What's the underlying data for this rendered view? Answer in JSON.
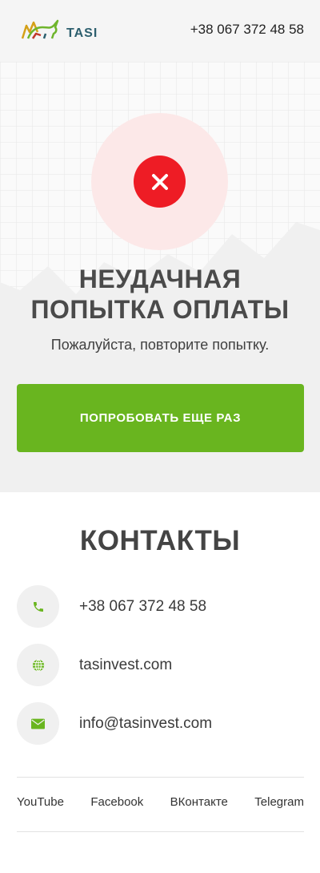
{
  "header": {
    "logo_text": "TASI",
    "phone": "+38 067 372 48 58"
  },
  "hero": {
    "title_line1": "НЕУДАЧНАЯ",
    "title_line2": "ПОПЫТКА ОПЛАТЫ",
    "subtitle": "Пожалуйста, повторите попытку.",
    "retry_label": "ПОПРОБОВАТЬ ЕЩЕ РАЗ",
    "status_icon": "close-icon"
  },
  "contacts": {
    "title": "КОНТАКТЫ",
    "items": [
      {
        "icon": "phone-icon",
        "text": "+38 067 372 48 58"
      },
      {
        "icon": "globe-icon",
        "text": "tasinvest.com"
      },
      {
        "icon": "mail-icon",
        "text": "info@tasinvest.com"
      }
    ]
  },
  "social": [
    "YouTube",
    "Facebook",
    "ВКонтакте",
    "Telegram"
  ],
  "colors": {
    "accent": "#69b51f",
    "error": "#ee1c25",
    "error_bg": "#fce8e8",
    "brand_text": "#2d5f6e"
  }
}
